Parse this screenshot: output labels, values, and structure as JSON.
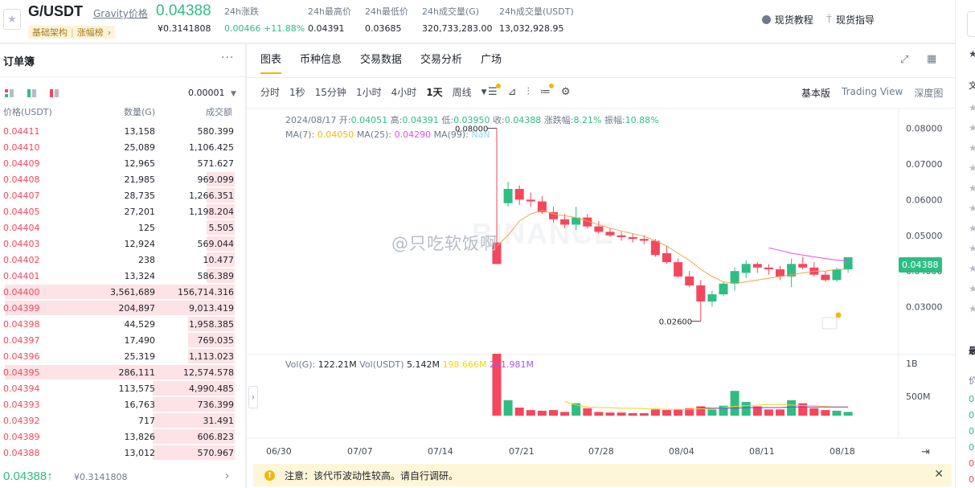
{
  "header": {
    "pair": "G/USDT",
    "pair_link": "Gravity价格",
    "tags": [
      "基础架构",
      "涨幅榜"
    ],
    "last_price": "0.04388",
    "last_price_cny": "¥0.3141808",
    "stats": [
      {
        "label": "24h涨跌",
        "value": "0.00466 +11.88%",
        "color": "#2ebd85"
      },
      {
        "label": "24h最高价",
        "value": "0.04391"
      },
      {
        "label": "24h最低价",
        "value": "0.03685"
      },
      {
        "label": "24h成交量(G)",
        "value": "320,733,283.00"
      },
      {
        "label": "24h成交量(USDT)",
        "value": "13,032,928.95"
      }
    ],
    "buttons": [
      "现货教程",
      "现货指导"
    ]
  },
  "orderbook": {
    "title": "订单簿",
    "precision": "0.00001",
    "columns": [
      "价格(USDT)",
      "数量(G)",
      "成交额"
    ],
    "asks": [
      {
        "price": "0.04411",
        "qty": "13,158",
        "total": "580.399",
        "depth": 0.0
      },
      {
        "price": "0.04410",
        "qty": "25,089",
        "total": "1,106.425",
        "depth": 0.0
      },
      {
        "price": "0.04409",
        "qty": "12,965",
        "total": "571.627",
        "depth": 0.0
      },
      {
        "price": "0.04408",
        "qty": "21,985",
        "total": "969.099",
        "depth": 0.12
      },
      {
        "price": "0.04407",
        "qty": "28,735",
        "total": "1,266.351",
        "depth": 0.12
      },
      {
        "price": "0.04405",
        "qty": "27,201",
        "total": "1,198.204",
        "depth": 0.12
      },
      {
        "price": "0.04404",
        "qty": "125",
        "total": "5.505",
        "depth": 0.12
      },
      {
        "price": "0.04403",
        "qty": "12,924",
        "total": "569.044",
        "depth": 0.12
      },
      {
        "price": "0.04402",
        "qty": "238",
        "total": "10.477",
        "depth": 0.12
      },
      {
        "price": "0.04401",
        "qty": "13,324",
        "total": "586.389",
        "depth": 0.12
      },
      {
        "price": "0.04400",
        "qty": "3,561,689",
        "total": "156,714.316",
        "depth": 0.98
      },
      {
        "price": "0.04399",
        "qty": "204,897",
        "total": "9,013.419",
        "depth": 0.98
      },
      {
        "price": "0.04398",
        "qty": "44,529",
        "total": "1,958.385",
        "depth": 0.2
      },
      {
        "price": "0.04397",
        "qty": "17,490",
        "total": "769.035",
        "depth": 0.2
      },
      {
        "price": "0.04396",
        "qty": "25,319",
        "total": "1,113.023",
        "depth": 0.2
      },
      {
        "price": "0.04395",
        "qty": "286,111",
        "total": "12,574.578",
        "depth": 0.98
      },
      {
        "price": "0.04394",
        "qty": "113,575",
        "total": "4,990.485",
        "depth": 0.35
      },
      {
        "price": "0.04393",
        "qty": "16,763",
        "total": "736.399",
        "depth": 0.35
      },
      {
        "price": "0.04392",
        "qty": "717",
        "total": "31.491",
        "depth": 0.35
      },
      {
        "price": "0.04389",
        "qty": "13,826",
        "total": "606.823",
        "depth": 0.35
      },
      {
        "price": "0.04388",
        "qty": "13,012",
        "total": "570.967",
        "depth": 0.35
      }
    ],
    "last_price": "0.04388↑",
    "last_price_cny": "¥0.3141808"
  },
  "chart": {
    "tabs": [
      "图表",
      "币种信息",
      "交易数据",
      "交易分析",
      "广场"
    ],
    "active_tab": 0,
    "intervals": [
      "分时",
      "1秒",
      "15分钟",
      "1小时",
      "4小时",
      "1天",
      "周线"
    ],
    "active_interval": 5,
    "views": [
      "基本版",
      "Trading View",
      "深度图"
    ],
    "active_view": 0,
    "info_line": {
      "date": "2024/08/17",
      "open_label": "开:",
      "open": "0.04051",
      "high_label": "高:",
      "high": "0.04391",
      "low_label": "低:",
      "low": "0.03950",
      "close_label": "收:",
      "close": "0.04388",
      "chg_label": "涨跌幅:",
      "chg": "8.21%",
      "amp_label": "振幅:",
      "amp": "10.88%"
    },
    "ma_line": {
      "ma7_label": "MA(7):",
      "ma7": "0.04050",
      "ma25_label": "MA(25):",
      "ma25": "0.04290",
      "ma99_label": "MA(99):",
      "ma99": "NaN"
    },
    "vol_line": {
      "vol_label": "Vol(G):",
      "vol": "122.21M",
      "volu_label": "Vol(USDT)",
      "volu": "5.142M",
      "ma1": "198.666M",
      "ma2": "221.981M"
    },
    "price_tag": "0.04388",
    "watermark": "@只吃软饭啊",
    "watermark_logo": "BINANCE",
    "notice": "注意：该代币波动性较高。请自行调研。",
    "colors": {
      "up": "#2ebd85",
      "down": "#f6465d",
      "ma7": "#f0b90b",
      "ma25": "#e84de1",
      "ma_long": "#7b3fe4",
      "accent": "#f0b90b"
    }
  },
  "chart_data": {
    "type": "candlestick",
    "x_tick_labels": [
      "06/30",
      "07/07",
      "07/14",
      "07/21",
      "07/28",
      "08/04",
      "08/11",
      "08/18"
    ],
    "y_tick_labels": [
      "0.08000",
      "0.07000",
      "0.06000",
      "0.05000",
      "0.04000",
      "0.03000"
    ],
    "ylim": [
      0.0225,
      0.0855
    ],
    "x_first_date": "07/18",
    "volume_axis_labels": [
      "1B",
      "500M"
    ],
    "high_annotation": "0.08000",
    "low_annotation": "0.02600",
    "candles": [
      [
        0.048,
        0.08,
        0.042,
        0.042,
        1.0
      ],
      [
        0.059,
        0.065,
        0.058,
        0.063,
        0.25
      ],
      [
        0.063,
        0.064,
        0.0585,
        0.06,
        0.13
      ],
      [
        0.06,
        0.062,
        0.058,
        0.0595,
        0.09
      ],
      [
        0.0595,
        0.061,
        0.056,
        0.0565,
        0.08
      ],
      [
        0.0565,
        0.058,
        0.0535,
        0.0545,
        0.09
      ],
      [
        0.0545,
        0.056,
        0.052,
        0.053,
        0.06
      ],
      [
        0.053,
        0.058,
        0.0515,
        0.055,
        0.2
      ],
      [
        0.055,
        0.056,
        0.052,
        0.0525,
        0.12
      ],
      [
        0.0525,
        0.054,
        0.0505,
        0.051,
        0.06
      ],
      [
        0.051,
        0.052,
        0.0495,
        0.05,
        0.05
      ],
      [
        0.05,
        0.051,
        0.0485,
        0.0495,
        0.05
      ],
      [
        0.0495,
        0.0505,
        0.048,
        0.049,
        0.04
      ],
      [
        0.049,
        0.05,
        0.0475,
        0.0485,
        0.04
      ],
      [
        0.0485,
        0.049,
        0.044,
        0.0445,
        0.1
      ],
      [
        0.045,
        0.047,
        0.042,
        0.0425,
        0.09
      ],
      [
        0.0425,
        0.0435,
        0.038,
        0.0385,
        0.1
      ],
      [
        0.0385,
        0.04,
        0.0355,
        0.036,
        0.12
      ],
      [
        0.036,
        0.0375,
        0.026,
        0.0315,
        0.15
      ],
      [
        0.0315,
        0.0345,
        0.03,
        0.0335,
        0.1
      ],
      [
        0.0335,
        0.037,
        0.033,
        0.0365,
        0.16
      ],
      [
        0.0365,
        0.041,
        0.0345,
        0.04,
        0.4
      ],
      [
        0.0395,
        0.043,
        0.038,
        0.042,
        0.22
      ],
      [
        0.042,
        0.0425,
        0.0395,
        0.041,
        0.15
      ],
      [
        0.041,
        0.042,
        0.039,
        0.0405,
        0.1
      ],
      [
        0.0405,
        0.0415,
        0.0375,
        0.0385,
        0.1
      ],
      [
        0.0385,
        0.0435,
        0.0355,
        0.042,
        0.25
      ],
      [
        0.042,
        0.044,
        0.0405,
        0.041,
        0.2
      ],
      [
        0.041,
        0.0425,
        0.0385,
        0.039,
        0.12
      ],
      [
        0.039,
        0.04,
        0.037,
        0.0375,
        0.09
      ],
      [
        0.0375,
        0.041,
        0.037,
        0.0405,
        0.08
      ],
      [
        0.0405,
        0.0439,
        0.0395,
        0.0439,
        0.06
      ]
    ],
    "ma7": [
      0.047,
      0.05,
      0.054,
      0.056,
      0.057,
      0.056,
      0.0555,
      0.055,
      0.054,
      0.053,
      0.052,
      0.0512,
      0.0505,
      0.0498,
      0.0485,
      0.047,
      0.045,
      0.043,
      0.0405,
      0.0385,
      0.037,
      0.0365,
      0.037,
      0.0375,
      0.038,
      0.0385,
      0.039,
      0.0395,
      0.04,
      0.04,
      0.0405,
      0.0405
    ],
    "ma25": [
      null,
      null,
      null,
      null,
      null,
      null,
      null,
      null,
      null,
      null,
      null,
      null,
      null,
      null,
      null,
      null,
      null,
      null,
      null,
      null,
      null,
      null,
      null,
      null,
      0.0465,
      0.0458,
      0.045,
      0.0445,
      0.044,
      0.0435,
      0.0431,
      0.0429
    ],
    "vol_ma1": [
      null,
      null,
      null,
      null,
      null,
      null,
      0.23,
      0.17,
      0.14,
      0.13,
      0.13,
      0.12,
      0.12,
      0.11,
      0.11,
      0.1,
      0.1,
      0.1,
      0.11,
      0.11,
      0.13,
      0.15,
      0.16,
      0.17,
      0.18,
      0.18,
      0.17,
      0.16,
      0.16,
      0.15,
      0.14,
      0.14
    ],
    "vol_ma2": [
      null,
      null,
      null,
      null,
      null,
      null,
      null,
      null,
      null,
      null,
      null,
      null,
      null,
      null,
      null,
      null,
      null,
      null,
      0.13,
      0.12,
      0.12,
      0.12,
      0.13,
      0.13,
      0.13,
      0.13,
      0.14,
      0.14,
      0.14,
      0.14,
      0.14,
      0.14
    ]
  }
}
